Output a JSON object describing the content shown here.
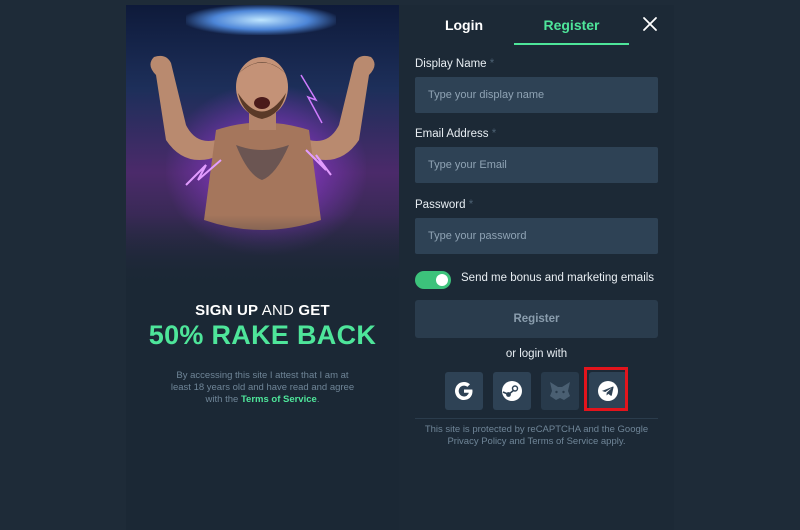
{
  "promo": {
    "title_bold_1": "SIGN UP",
    "title_thin": " AND ",
    "title_bold_2": "GET",
    "highlight": "50% RAKE BACK",
    "terms_prefix": "By accessing this site I attest that I am at least 18 years old and have read and agree with the ",
    "terms_link": "Terms of Service",
    "terms_suffix": "."
  },
  "tabs": {
    "login": "Login",
    "register": "Register"
  },
  "form": {
    "display_name_label": "Display Name",
    "display_name_placeholder": "Type your display name",
    "email_label": "Email Address",
    "email_placeholder": "Type your Email",
    "password_label": "Password",
    "password_placeholder": "Type your password",
    "required_mark": " *",
    "marketing_toggle_label": "Send me bonus and marketing emails",
    "marketing_toggle_on": true,
    "register_button": "Register",
    "or_login_with": "or login with"
  },
  "social_icons": [
    "google-icon",
    "steam-icon",
    "metamask-icon",
    "telegram-icon"
  ],
  "recaptcha": "This site is protected by reCAPTCHA and the Google Privacy Policy and Terms of Service apply.",
  "colors": {
    "accent": "#4ee59a",
    "page_bg": "#1e2b38",
    "input_bg": "#2e4255",
    "highlight_box": "#e3141c"
  }
}
